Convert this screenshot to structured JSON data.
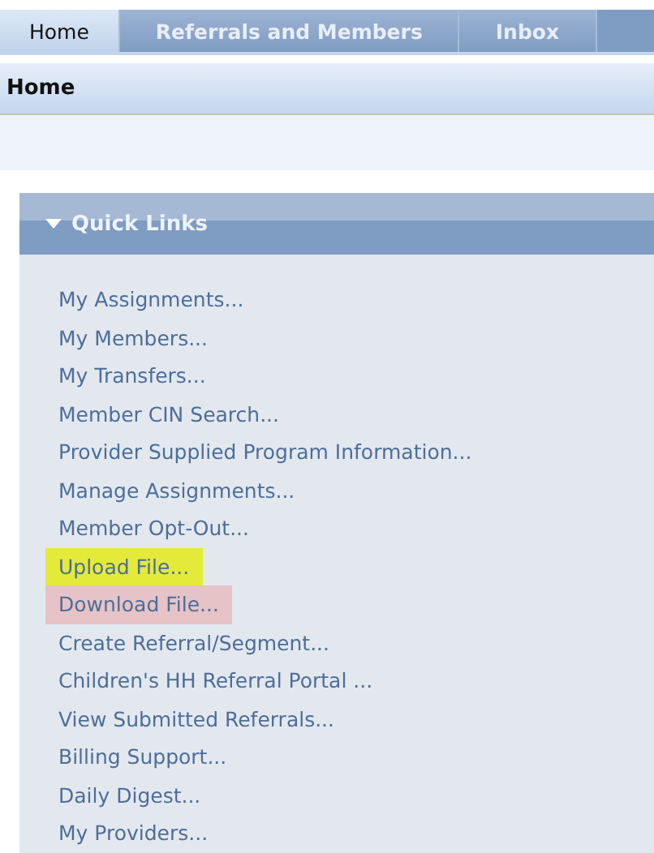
{
  "tabs": [
    {
      "label": "Home",
      "selected": true
    },
    {
      "label": "Referrals and Members",
      "selected": false
    },
    {
      "label": "Inbox",
      "selected": false
    }
  ],
  "page_header": {
    "title": "Home"
  },
  "quick_links": {
    "title": "Quick Links",
    "expanded": true,
    "items": [
      {
        "label": "My Assignments..."
      },
      {
        "label": "My Members..."
      },
      {
        "label": "My Transfers..."
      },
      {
        "label": "Member CIN Search..."
      },
      {
        "label": "Provider Supplied Program Information..."
      },
      {
        "label": "Manage Assignments..."
      },
      {
        "label": "Member Opt-Out..."
      },
      {
        "label": "Upload File...",
        "color": "#e4ea3a"
      },
      {
        "label": "Download File...",
        "color": "#e6c3c6"
      },
      {
        "label": "Create Referral/Segment..."
      },
      {
        "label": "Children's HH Referral Portal ..."
      },
      {
        "label": "View Submitted Referrals..."
      },
      {
        "label": "Billing Support..."
      },
      {
        "label": "Daily Digest..."
      },
      {
        "label": "My Providers..."
      }
    ]
  }
}
